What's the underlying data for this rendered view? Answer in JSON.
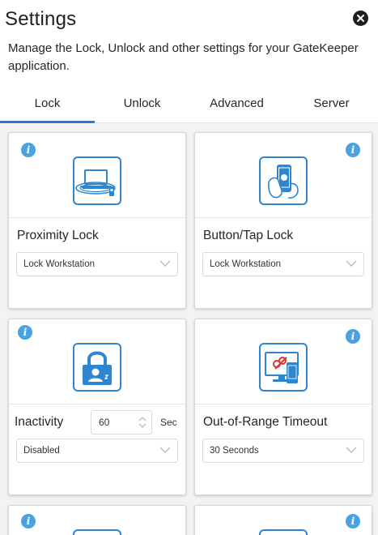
{
  "header": {
    "title": "Settings",
    "close_icon": "close-icon"
  },
  "description": "Manage the Lock, Unlock and other settings for your GateKeeper application.",
  "tabs": [
    {
      "label": "Lock",
      "active": true
    },
    {
      "label": "Unlock",
      "active": false
    },
    {
      "label": "Advanced",
      "active": false
    },
    {
      "label": "Server",
      "active": false
    }
  ],
  "colors": {
    "accent": "#2a79d6",
    "icon_blue": "#2e86d0",
    "info_blue": "#4aa3e0"
  },
  "cards": {
    "proximity": {
      "label": "Proximity Lock",
      "select_value": "Lock Workstation",
      "icon": "laptop-proximity-icon"
    },
    "button_tap": {
      "label": "Button/Tap Lock",
      "select_value": "Lock Workstation",
      "icon": "phone-tap-icon"
    },
    "inactivity": {
      "label": "Inactivity",
      "value": "60",
      "unit": "Sec",
      "select_value": "Disabled",
      "icon": "padlock-user-icon"
    },
    "out_of_range": {
      "label": "Out-of-Range Timeout",
      "select_value": "30 Seconds",
      "icon": "monitor-timeout-icon"
    }
  }
}
